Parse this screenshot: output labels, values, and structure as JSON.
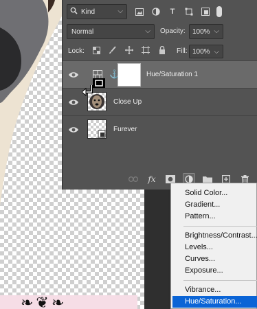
{
  "filter": {
    "kind_label": "Kind"
  },
  "blend": {
    "mode": "Normal",
    "opacity_label": "Opacity:",
    "opacity_value": "100%",
    "lock_label": "Lock:",
    "fill_label": "Fill:",
    "fill_value": "100%"
  },
  "layers": [
    {
      "name": "Hue/Saturation 1",
      "selected": true
    },
    {
      "name": "Close Up",
      "selected": false
    },
    {
      "name": "Furever",
      "selected": false
    }
  ],
  "menu": {
    "group1": [
      "Solid Color...",
      "Gradient...",
      "Pattern..."
    ],
    "group2": [
      "Brightness/Contrast...",
      "Levels...",
      "Curves...",
      "Exposure..."
    ],
    "group3": [
      "Vibrance...",
      "Hue/Saturation..."
    ],
    "highlighted": "Hue/Saturation..."
  },
  "colors": {
    "panel_bg": "#535353",
    "selected_layer_bg": "#6a6a6a",
    "menu_highlight": "#0a64d6",
    "menu_bg": "#f0f0f0"
  }
}
